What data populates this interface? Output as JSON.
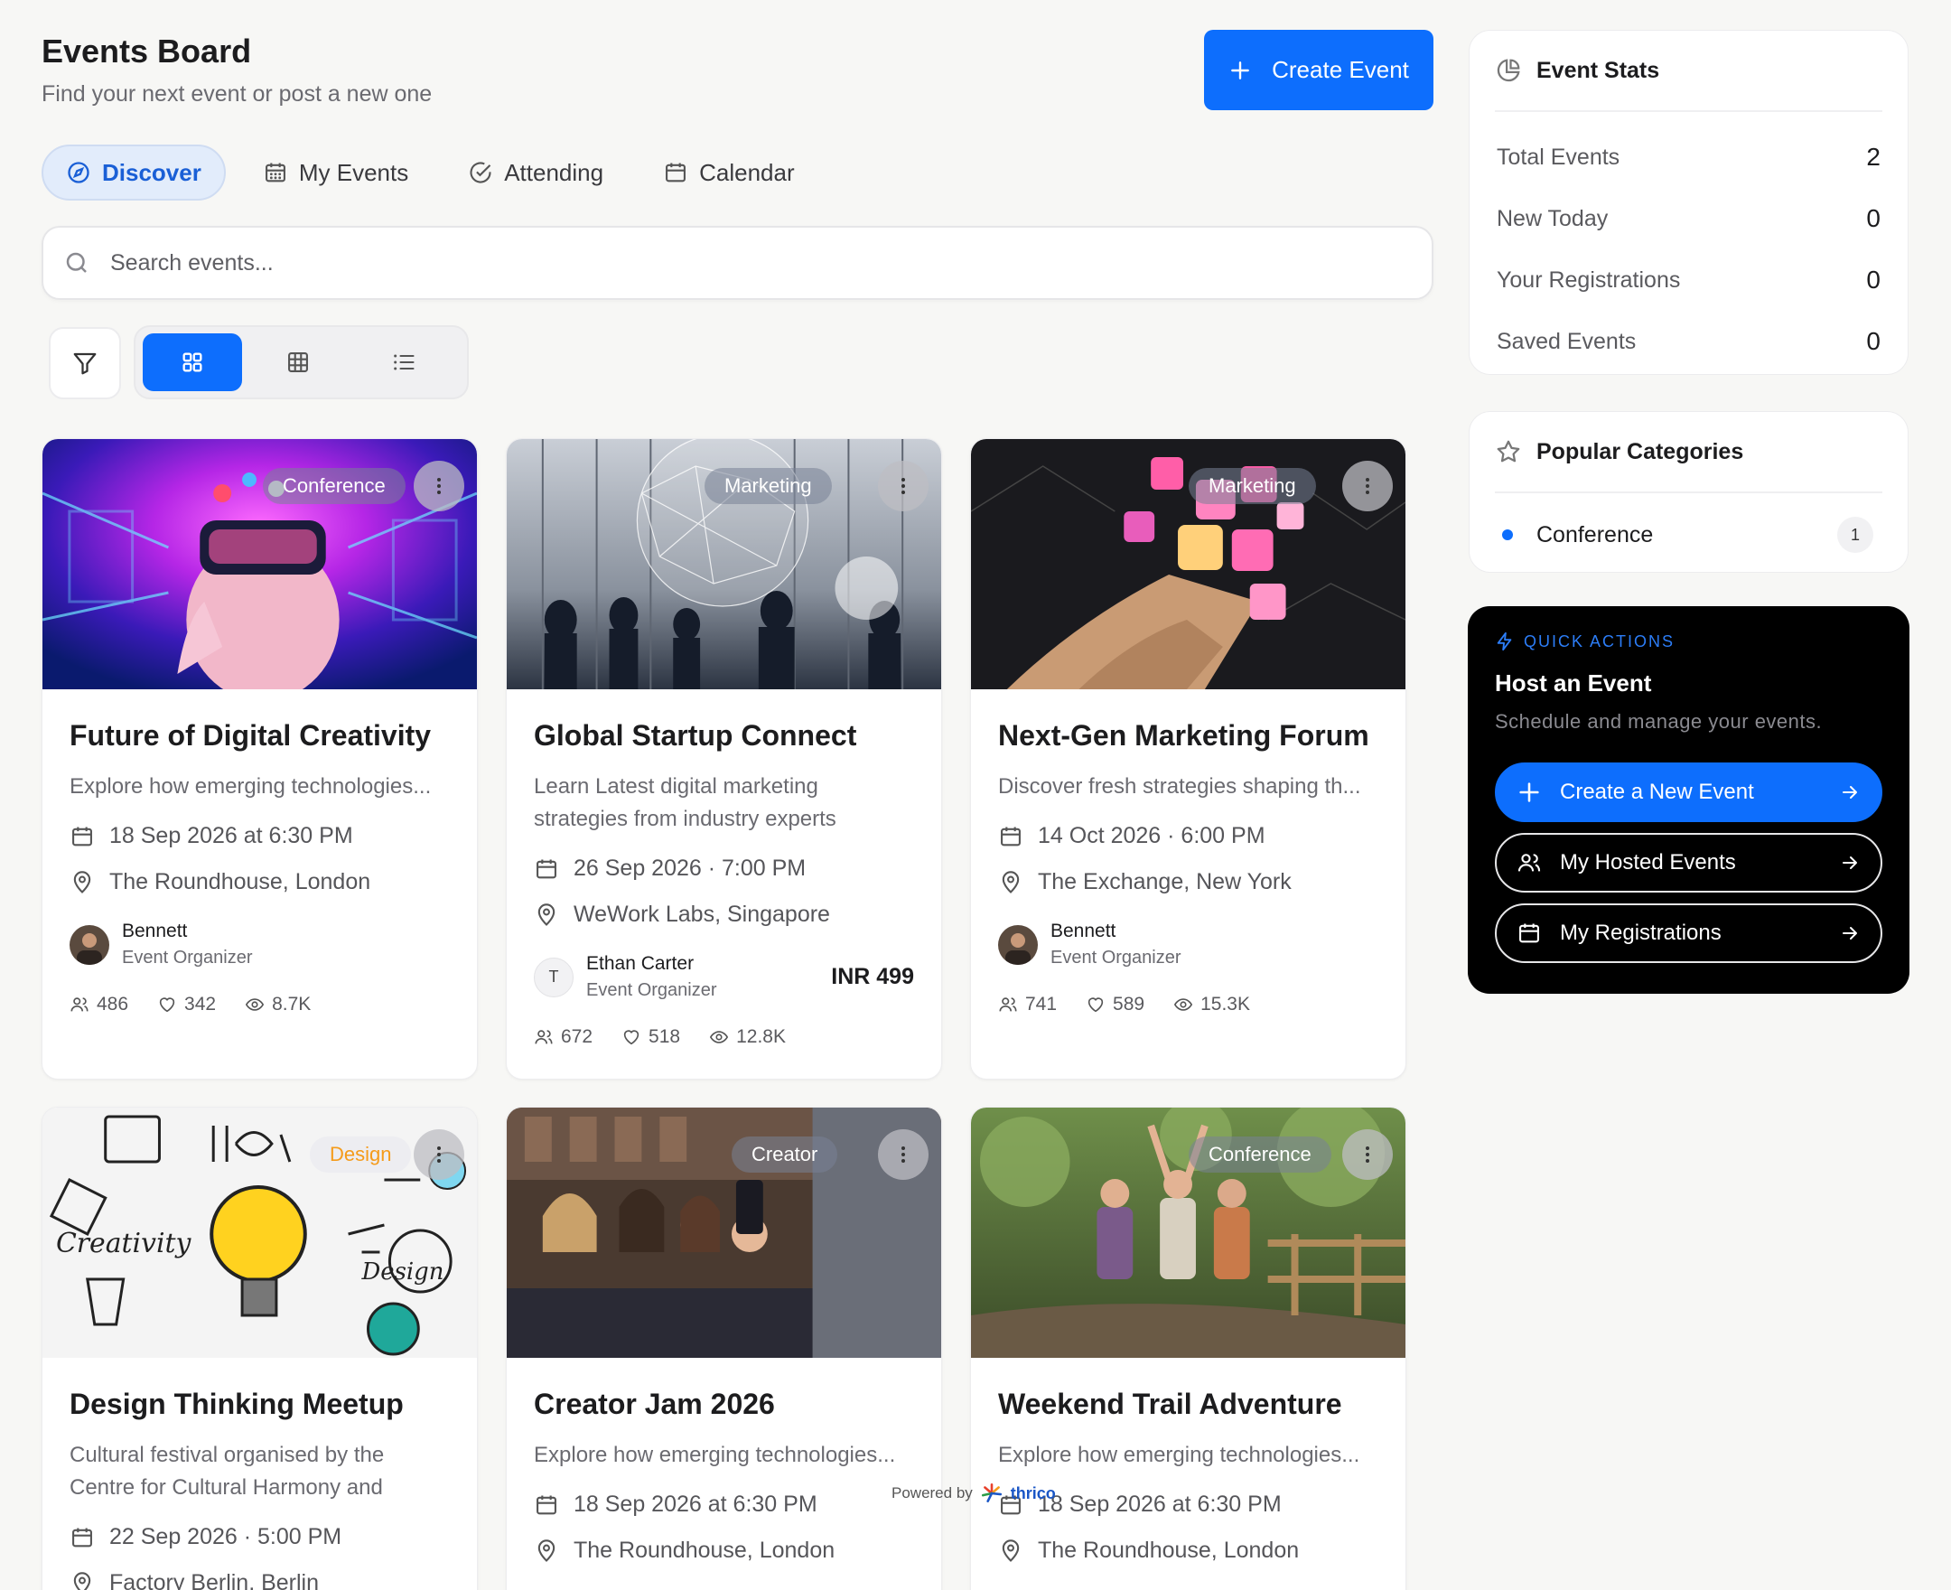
{
  "header": {
    "title": "Events Board",
    "subtitle": "Find your next event or post a new one",
    "create_label": "Create Event"
  },
  "tabs": [
    {
      "label": "Discover",
      "icon": "compass-icon",
      "active": true
    },
    {
      "label": "My Events",
      "icon": "calendar-grid-icon"
    },
    {
      "label": "Attending",
      "icon": "check-circle-icon"
    },
    {
      "label": "Calendar",
      "icon": "calendar-icon"
    }
  ],
  "search": {
    "placeholder": "Search events...",
    "value": ""
  },
  "view_modes": [
    "grid-large",
    "grid-small",
    "list"
  ],
  "cards": [
    {
      "badge": "Conference",
      "title": "Future of Digital Creativity",
      "desc": "Explore how emerging technologies...",
      "date": "18 Sep 2026 at 6:30 PM",
      "location": "The Roundhouse, London",
      "organizer": "Bennett",
      "role": "Event Organizer",
      "attendees": "486",
      "likes": "342",
      "views": "8.7K"
    },
    {
      "badge": "Marketing",
      "title": "Global Startup Connect",
      "desc": "Learn Latest digital marketing strategies from industry experts",
      "date": "26 Sep 2026 · 7:00 PM",
      "location": "WeWork Labs, Singapore",
      "organizer": "Ethan Carter",
      "organizer_initial": "T",
      "role": "Event Organizer",
      "price": "INR 499",
      "attendees": "672",
      "likes": "518",
      "views": "12.8K"
    },
    {
      "badge": "Marketing",
      "title": "Next-Gen Marketing Forum",
      "desc": "Discover fresh strategies shaping th...",
      "date": "14 Oct 2026 · 6:00 PM",
      "location": "The Exchange, New York",
      "organizer": "Bennett",
      "role": "Event Organizer",
      "attendees": "741",
      "likes": "589",
      "views": "15.3K"
    },
    {
      "badge": "Design",
      "title": "Design Thinking Meetup",
      "desc": "Cultural festival organised by the Centre for Cultural Harmony and",
      "date": "22 Sep 2026 · 5:00 PM",
      "location": "Factory Berlin, Berlin"
    },
    {
      "badge": "Creator",
      "title": "Creator Jam 2026",
      "desc": "Explore how emerging technologies...",
      "date": "18 Sep 2026 at 6:30 PM",
      "location": "The Roundhouse, London"
    },
    {
      "badge": "Conference",
      "title": "Weekend Trail Adventure",
      "desc": "Explore how emerging technologies...",
      "date": "18 Sep 2026 at 6:30 PM",
      "location": "The Roundhouse, London"
    }
  ],
  "stats_panel": {
    "title": "Event Stats",
    "rows": [
      {
        "label": "Total Events",
        "value": "2"
      },
      {
        "label": "New Today",
        "value": "0"
      },
      {
        "label": "Your Registrations",
        "value": "0"
      },
      {
        "label": "Saved Events",
        "value": "0"
      }
    ]
  },
  "categories_panel": {
    "title": "Popular Categories",
    "items": [
      {
        "label": "Conference",
        "count": "1"
      }
    ]
  },
  "quick_actions": {
    "label": "QUICK ACTIONS",
    "title": "Host an Event",
    "subtitle": "Schedule and manage your events.",
    "buttons": [
      {
        "label": "Create a New Event",
        "icon": "plus-icon"
      },
      {
        "label": "My Hosted Events",
        "icon": "users-icon"
      },
      {
        "label": "My Registrations",
        "icon": "calendar-icon"
      }
    ]
  },
  "footer": {
    "powered_label": "Powered by",
    "brand": "thrico"
  },
  "colors": {
    "accent": "#0d6efd",
    "accent_soft": "#e2ecfb",
    "page_bg": "#f7f7f5",
    "quick_bg": "#000000"
  }
}
